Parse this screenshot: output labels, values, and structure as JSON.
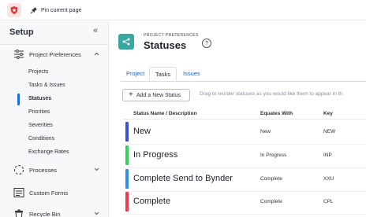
{
  "topbar": {
    "pin_label": "Pin current page"
  },
  "sidebar": {
    "title": "Setup",
    "collapse_glyph": "«",
    "sections": [
      {
        "label": "Project Preferences",
        "icon": "sliders-icon",
        "chevron": "^",
        "expanded": true
      },
      {
        "label": "Processes",
        "icon": "process-icon",
        "chevron": "v"
      },
      {
        "label": "Custom Forms",
        "icon": "form-icon",
        "chevron": ""
      },
      {
        "label": "Recycle Bin",
        "icon": "trash-icon",
        "chevron": "v"
      }
    ],
    "sub_items": [
      "Projects",
      "Tasks & Issues",
      "Statuses",
      "Priorities",
      "Severities",
      "Conditions",
      "Exchange Rates"
    ],
    "active_sub_item": "Statuses"
  },
  "page": {
    "eyebrow": "PROJECT PREFERENCES",
    "title": "Statuses",
    "help_glyph": "?"
  },
  "tabs": [
    {
      "label": "Project",
      "selected": false
    },
    {
      "label": "Tasks",
      "selected": true
    },
    {
      "label": "Issues",
      "selected": false
    }
  ],
  "toolbar": {
    "add_label": "Add a New Status",
    "add_glyph": "+",
    "hint": "Drag to reorder statuses as you would like them to appear in th"
  },
  "table": {
    "columns": [
      "Status Name / Description",
      "Equates With",
      "Key"
    ],
    "rows": [
      {
        "name": "New",
        "equates": "New",
        "key": "NEW",
        "color": "#3b4fd8"
      },
      {
        "name": "In Progress",
        "equates": "In Progress",
        "key": "INP",
        "color": "#34d15a"
      },
      {
        "name": "Complete Send to Bynder",
        "equates": "Complete",
        "key": "XXU",
        "color": "#2f8fe6"
      },
      {
        "name": "Complete",
        "equates": "Complete",
        "key": "CPL",
        "color": "#f03a4b"
      }
    ]
  },
  "colors": {
    "accent": "#1f6fd1",
    "page_icon": "#3aa7a3",
    "logo_bg": "#fbe3e3",
    "logo_fg": "#e03a3a"
  }
}
